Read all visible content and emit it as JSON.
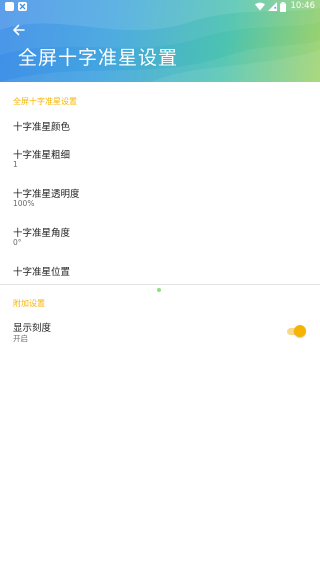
{
  "status_bar": {
    "time": "10:46"
  },
  "header": {
    "title": "全屏十字准星设置"
  },
  "sections": [
    {
      "category": "全屏十字准星设置",
      "items": [
        {
          "title": "十字准星颜色",
          "summary": ""
        },
        {
          "title": "十字准星粗细",
          "summary": "1"
        },
        {
          "title": "十字准星透明度",
          "summary": "100%"
        },
        {
          "title": "十字准星角度",
          "summary": "0°"
        },
        {
          "title": "十字准星位置",
          "summary": ""
        }
      ]
    },
    {
      "category": "附加设置",
      "items": [
        {
          "title": "显示刻度",
          "summary": "开启",
          "toggle": true
        }
      ]
    }
  ],
  "colors": {
    "accent": "#f6b400",
    "header_start": "#3f8ee8",
    "header_end": "#9ed26a"
  }
}
